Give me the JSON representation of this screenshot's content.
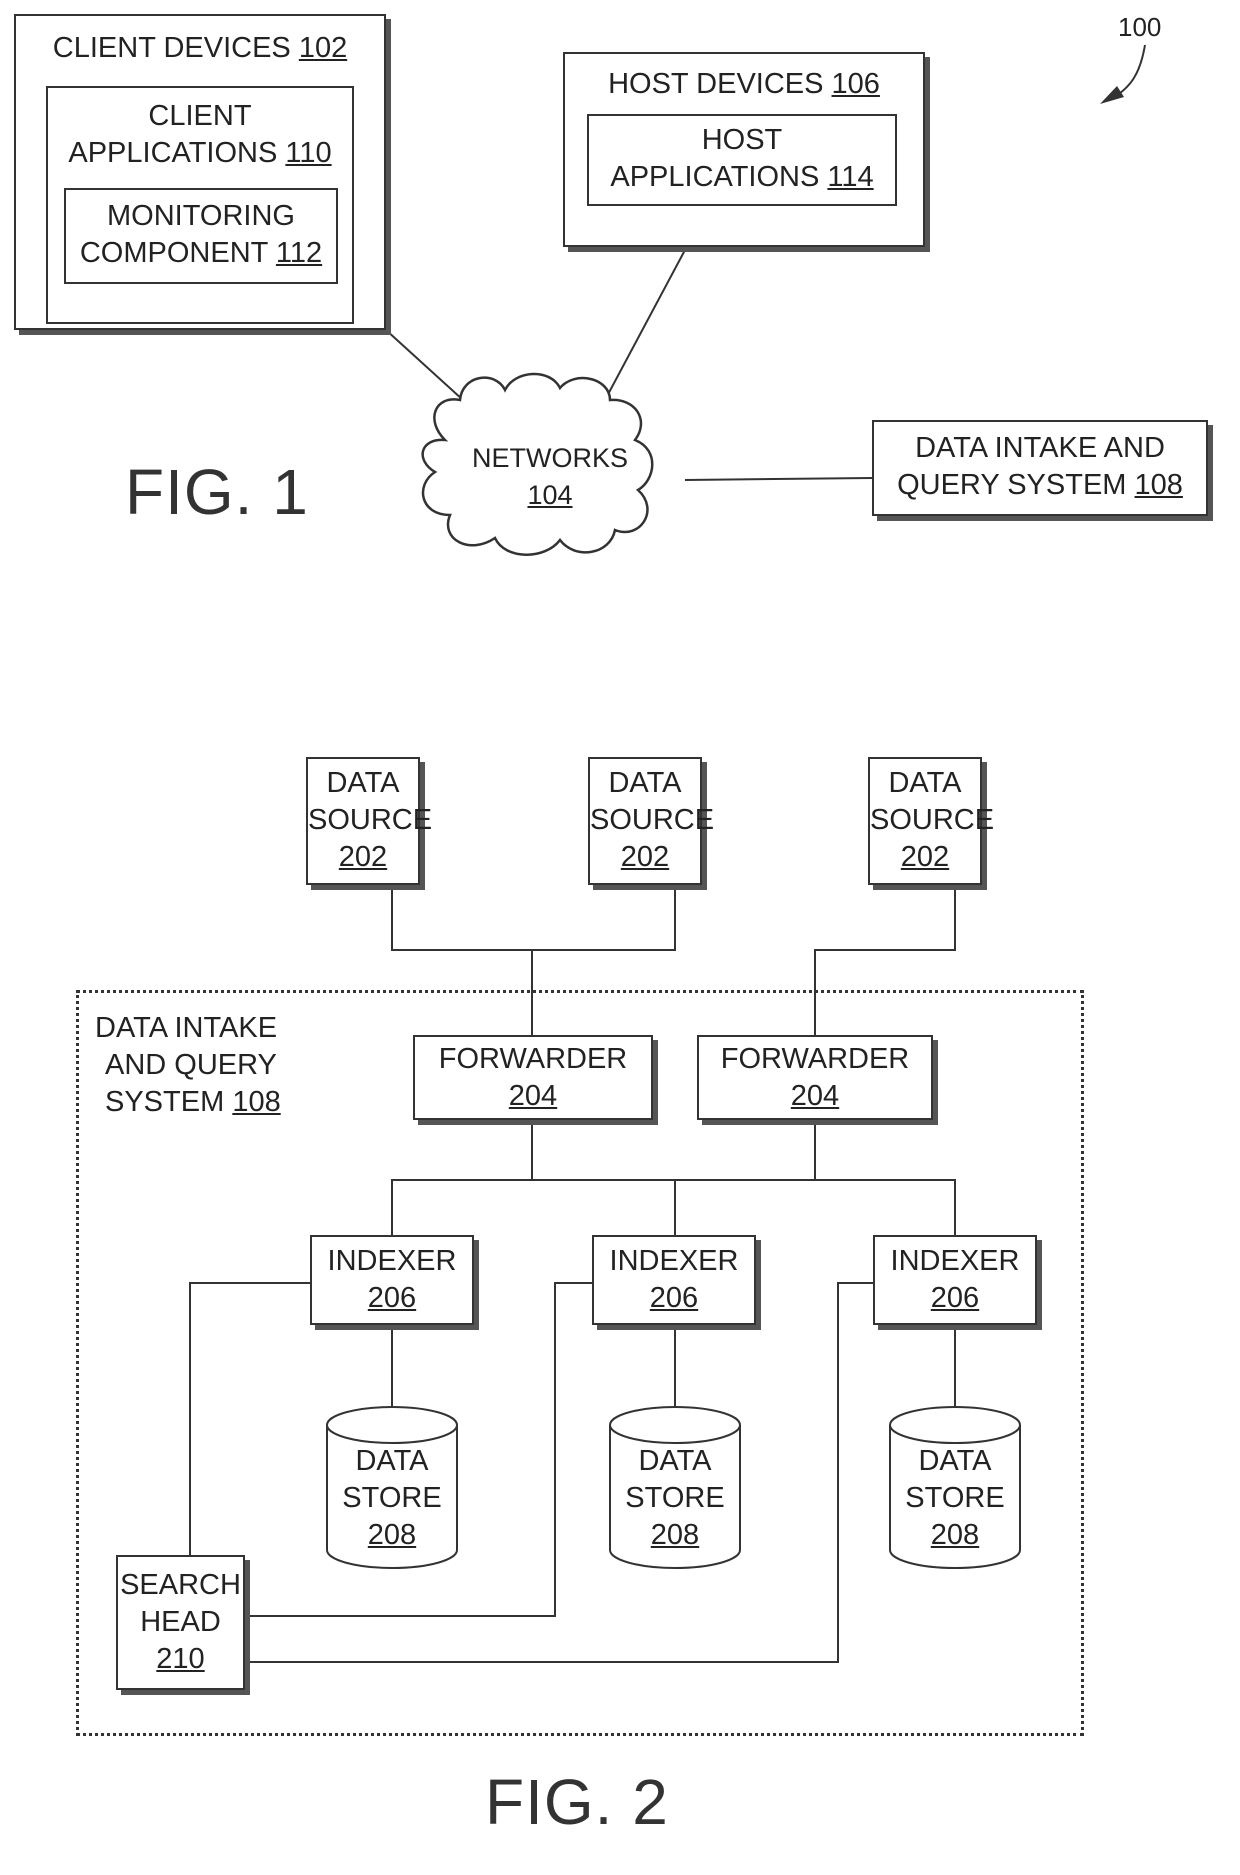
{
  "ref_label": "100",
  "fig1": {
    "title": "FIG. 1",
    "client_devices": {
      "label": "CLIENT DEVICES",
      "num": "102"
    },
    "client_applications": {
      "line1": "CLIENT",
      "line2": "APPLICATIONS",
      "num": "110"
    },
    "monitoring_component": {
      "line1": "MONITORING",
      "line2": "COMPONENT",
      "num": "112"
    },
    "host_devices": {
      "label": "HOST DEVICES",
      "num": "106"
    },
    "host_applications": {
      "line1": "HOST",
      "line2": "APPLICATIONS",
      "num": "114"
    },
    "networks": {
      "label": "NETWORKS",
      "num": "104"
    },
    "data_intake": {
      "line1": "DATA INTAKE AND",
      "line2": "QUERY SYSTEM",
      "num": "108"
    }
  },
  "fig2": {
    "title": "FIG. 2",
    "system": {
      "line1": "DATA INTAKE",
      "line2": "AND QUERY",
      "line3": "SYSTEM",
      "num": "108"
    },
    "data_sources": [
      {
        "line1": "DATA",
        "line2": "SOURCE",
        "num": "202"
      },
      {
        "line1": "DATA",
        "line2": "SOURCE",
        "num": "202"
      },
      {
        "line1": "DATA",
        "line2": "SOURCE",
        "num": "202"
      }
    ],
    "forwarders": [
      {
        "label": "FORWARDER",
        "num": "204"
      },
      {
        "label": "FORWARDER",
        "num": "204"
      }
    ],
    "indexers": [
      {
        "label": "INDEXER",
        "num": "206"
      },
      {
        "label": "INDEXER",
        "num": "206"
      },
      {
        "label": "INDEXER",
        "num": "206"
      }
    ],
    "data_stores": [
      {
        "line1": "DATA",
        "line2": "STORE",
        "num": "208"
      },
      {
        "line1": "DATA",
        "line2": "STORE",
        "num": "208"
      },
      {
        "line1": "DATA",
        "line2": "STORE",
        "num": "208"
      }
    ],
    "search_head": {
      "line1": "SEARCH",
      "line2": "HEAD",
      "num": "210"
    }
  }
}
